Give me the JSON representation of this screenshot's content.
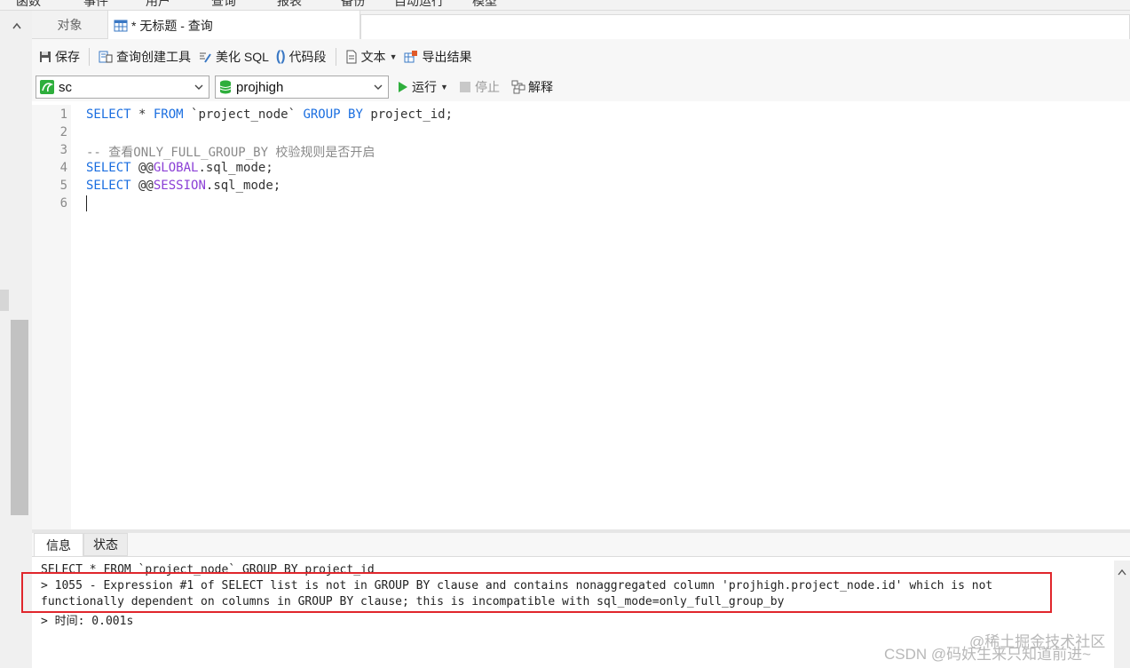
{
  "menubar": {
    "items": [
      "函数",
      "事件",
      "用户",
      "查询",
      "报表",
      "备份",
      "自动运行",
      "模型"
    ]
  },
  "tabs": {
    "objects_label": "对象",
    "query_label": "* 无标题 - 查询"
  },
  "toolbar": {
    "save_label": "保存",
    "query_builder_label": "查询创建工具",
    "beautify_label": "美化 SQL",
    "snippet_label": "代码段",
    "text_label": "文本",
    "export_label": "导出结果"
  },
  "selectors": {
    "connection_value": "sc",
    "database_value": "projhigh",
    "run_label": "运行",
    "stop_label": "停止",
    "explain_label": "解释"
  },
  "editor": {
    "line_numbers": [
      "1",
      "2",
      "3",
      "4",
      "5",
      "6"
    ],
    "line1": {
      "kw1": "SELECT",
      "t1": " * ",
      "kw2": "FROM",
      "t2": " `project_node` ",
      "kw3": "GROUP BY",
      "t3": " project_id;"
    },
    "line3": {
      "comment": "-- 查看ONLY_FULL_GROUP_BY 校验规则是否开启"
    },
    "line4": {
      "kw": "SELECT",
      "t1": " @@",
      "var": "GLOBAL",
      "t2": ".sql_mode;"
    },
    "line5": {
      "kw": "SELECT",
      "t1": " @@",
      "var": "SESSION",
      "t2": ".sql_mode;"
    }
  },
  "result": {
    "tab_info": "信息",
    "tab_status": "状态",
    "lines": [
      "SELECT * FROM `project_node` GROUP BY project_id",
      "> 1055 - Expression #1 of SELECT list is not in GROUP BY clause and contains nonaggregated column 'projhigh.project_node.id' which is not",
      "functionally dependent on columns in GROUP BY clause; this is incompatible with sql_mode=only_full_group_by",
      "> 时间: 0.001s"
    ]
  },
  "watermarks": {
    "juejin": "@稀土掘金技术社区",
    "csdn": "CSDN @码妖生来只知道前进~"
  },
  "colors": {
    "keyword": "#1a6ee0",
    "variable": "#8b3fd6",
    "comment": "#8a8a8a",
    "highlight_border": "#e0262c",
    "run_green": "#2eae3c"
  }
}
